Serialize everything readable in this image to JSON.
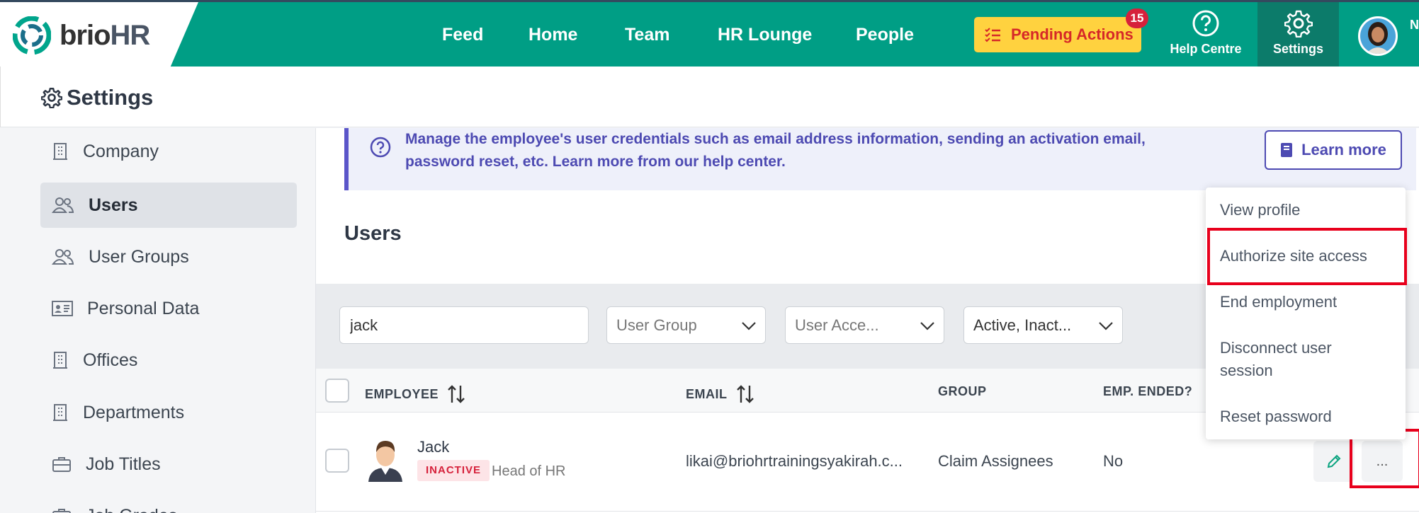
{
  "brand": {
    "logo_prefix": "brio",
    "logo_suffix": "HR"
  },
  "topnav": {
    "links": [
      "Feed",
      "Home",
      "Team",
      "HR Lounge",
      "People"
    ],
    "pending_label": "Pending Actions",
    "pending_count": "15",
    "help_label": "Help Centre",
    "settings_label": "Settings",
    "cutoff_text": "N"
  },
  "page": {
    "title": "Settings"
  },
  "sidebar": {
    "items": [
      {
        "label": "Company",
        "icon": "building-icon"
      },
      {
        "label": "Users",
        "icon": "users-icon",
        "active": true
      },
      {
        "label": "User Groups",
        "icon": "users-icon"
      },
      {
        "label": "Personal Data",
        "icon": "id-card-icon"
      },
      {
        "label": "Offices",
        "icon": "building-icon"
      },
      {
        "label": "Departments",
        "icon": "building-icon"
      },
      {
        "label": "Job Titles",
        "icon": "briefcase-icon"
      },
      {
        "label": "Job Grades",
        "icon": "briefcase-icon"
      }
    ]
  },
  "info": {
    "text": "Manage the employee's user credentials such as email address information, sending an activation email, password reset, etc. Learn more from our help center.",
    "learn_more": "Learn more"
  },
  "users_section": {
    "heading": "Users"
  },
  "filters": {
    "search_value": "jack",
    "user_group": "User Group",
    "user_access": "User Acce...",
    "status": "Active, Inact..."
  },
  "table": {
    "headers": {
      "employee": "EMPLOYEE",
      "email": "EMAIL",
      "group": "GROUP",
      "emp_ended": "EMP. ENDED?"
    },
    "rows": [
      {
        "name": "Jack",
        "status": "INACTIVE",
        "title": "Head of HR",
        "email": "likai@briohrtrainingsyakirah.c...",
        "group": "Claim Assignees",
        "emp_ended": "No"
      }
    ],
    "more_label": "..."
  },
  "menu": {
    "items": [
      "View profile",
      "Authorize site access",
      "End employment",
      "Disconnect user session",
      "Reset password"
    ]
  },
  "colors": {
    "primary": "#009e85",
    "accent_purple": "#4d4ab2",
    "highlight_red": "#e8001c",
    "pending_yellow": "#ffd23f"
  }
}
